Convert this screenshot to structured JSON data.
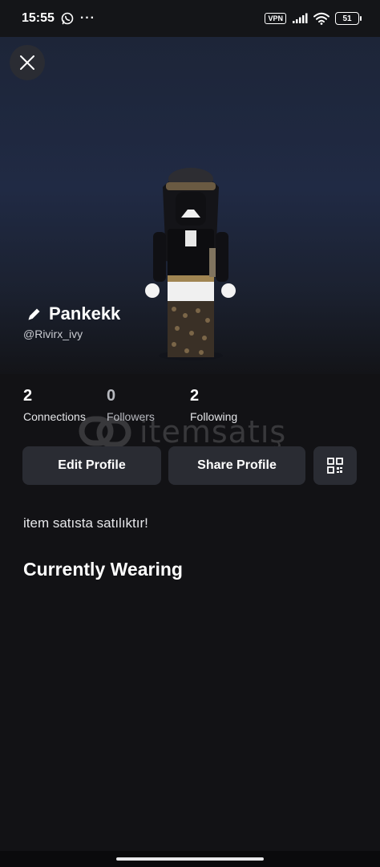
{
  "status_bar": {
    "time": "15:55",
    "dots": "···",
    "vpn_label": "VPN",
    "battery": "51",
    "icons": [
      "whatsapp-icon",
      "signal-icon",
      "wifi-icon",
      "battery-icon"
    ]
  },
  "profile": {
    "display_name": "Pankekk",
    "username": "@Rivirx_ivy",
    "stats": [
      {
        "value": "2",
        "label": "Connections"
      },
      {
        "value": "0",
        "label": "Followers"
      },
      {
        "value": "2",
        "label": "Following"
      }
    ],
    "bio": "item satısta satılıktır!"
  },
  "actions": {
    "edit_label": "Edit Profile",
    "share_label": "Share Profile",
    "qr_icon": "qr-code-icon"
  },
  "sections": {
    "currently_wearing": "Currently Wearing"
  },
  "watermark": {
    "text": "itemsatış"
  },
  "colors": {
    "background": "#121215",
    "button": "#2a2c33",
    "hero_top": "#1d2538"
  }
}
